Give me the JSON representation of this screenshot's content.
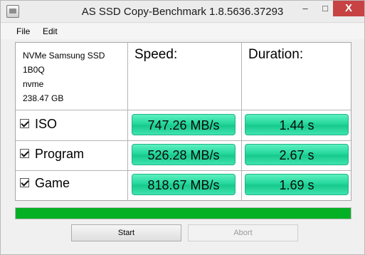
{
  "window": {
    "title": "AS SSD Copy-Benchmark 1.8.5636.37293",
    "close_glyph": "X",
    "minimize_glyph": "–",
    "maximize_glyph": "□"
  },
  "menu": {
    "file": "File",
    "edit": "Edit"
  },
  "drive": {
    "model": "NVMe Samsung SSD",
    "firmware": "1B0Q",
    "driver": "nvme",
    "capacity": "238.47 GB"
  },
  "headers": {
    "speed": "Speed:",
    "duration": "Duration:"
  },
  "rows": [
    {
      "label": "ISO",
      "checked": true,
      "speed": "747.26 MB/s",
      "duration": "1.44 s"
    },
    {
      "label": "Program",
      "checked": true,
      "speed": "526.28 MB/s",
      "duration": "2.67 s"
    },
    {
      "label": "Game",
      "checked": true,
      "speed": "818.67 MB/s",
      "duration": "1.69 s"
    }
  ],
  "progress": {
    "percent": 100,
    "color": "#06b025"
  },
  "buttons": {
    "start": "Start",
    "abort": "Abort"
  },
  "colors": {
    "result_box": "#25d89c",
    "close_button": "#c74343"
  }
}
